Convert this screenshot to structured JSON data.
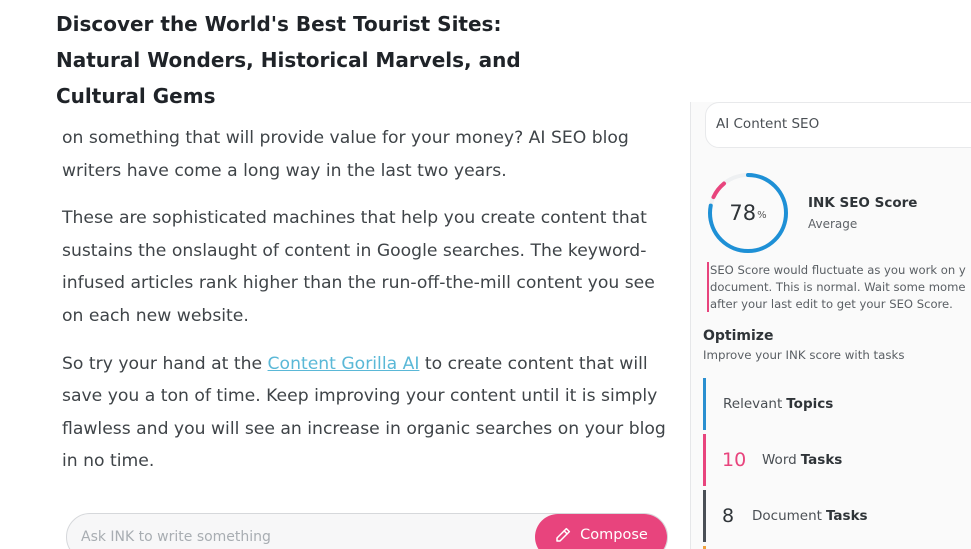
{
  "article": {
    "title": "Discover the World's Best Tourist Sites: Natural Wonders, Historical Marvels, and Cultural Gems",
    "paragraphs": [
      "on something that will provide value for your money? AI SEO blog writers have come a long way in the last two years.",
      "These are sophisticated machines that help you create content that sustains the onslaught of content in Google searches. The keyword-infused articles rank higher than the run-off-the-mill content you see on each new website."
    ],
    "p3_before": "So try your hand at the ",
    "p3_link": "Content Gorilla AI",
    "p3_after": " to create content that will save you a ton of time. Keep improving your content until it is simply flawless and you will see an increase in organic searches on your blog in no time."
  },
  "ask": {
    "placeholder": "Ask INK to write something",
    "compose_label": "Compose",
    "compose_icon": "pencil-icon"
  },
  "seo_panel": {
    "tab_label": "AI Content SEO",
    "score": "78",
    "score_pct_symbol": "%",
    "score_value": 0.78,
    "score_title": "INK SEO Score",
    "score_rating": "Average",
    "note_lines": [
      "SEO Score would fluctuate as you work on y",
      "document. This is normal. Wait some mome",
      "after your last edit to get your SEO Score."
    ],
    "optimize_title": "Optimize",
    "optimize_sub": "Improve your INK score with tasks",
    "tasks": [
      {
        "label": "Relevant",
        "bold": "Topics",
        "count": ""
      },
      {
        "label": "Word",
        "bold": "Tasks",
        "count": "10"
      },
      {
        "label": "Document",
        "bold": "Tasks",
        "count": "8"
      }
    ]
  },
  "colors": {
    "accent_pink": "#e8447d",
    "ring_blue": "#1e90d6",
    "link": "#5ab8d7",
    "topics_bar": "#2a8fd0",
    "doc_bar": "#4a4f56"
  }
}
